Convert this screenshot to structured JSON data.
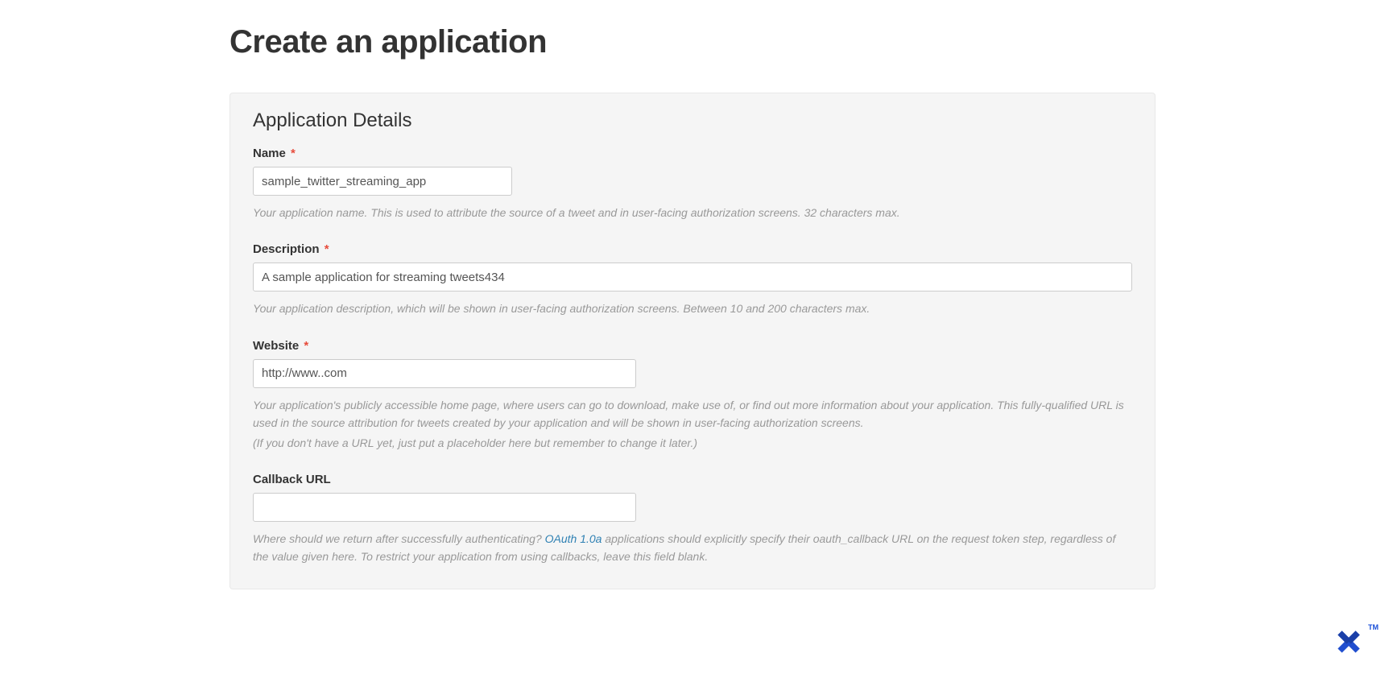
{
  "page": {
    "title": "Create an application"
  },
  "section": {
    "title": "Application Details"
  },
  "fields": {
    "name": {
      "label": "Name",
      "required_mark": "*",
      "value": "sample_twitter_streaming_app",
      "help": "Your application name. This is used to attribute the source of a tweet and in user-facing authorization screens. 32 characters max."
    },
    "description": {
      "label": "Description",
      "required_mark": "*",
      "value": "A sample application for streaming tweets434",
      "help": "Your application description, which will be shown in user-facing authorization screens. Between 10 and 200 characters max."
    },
    "website": {
      "label": "Website",
      "required_mark": "*",
      "value": "http://www..com",
      "help_line1": "Your application's publicly accessible home page, where users can go to download, make use of, or find out more information about your application. This fully-qualified URL is used in the source attribution for tweets created by your application and will be shown in user-facing authorization screens.",
      "help_line2": "(If you don't have a URL yet, just put a placeholder here but remember to change it later.)"
    },
    "callback": {
      "label": "Callback URL",
      "value": "",
      "help_before_link": "Where should we return after successfully authenticating? ",
      "link_text": "OAuth 1.0a",
      "help_after_link": " applications should explicitly specify their oauth_callback URL on the request token step, regardless of the value given here. To restrict your application from using callbacks, leave this field blank."
    }
  },
  "watermark": {
    "tm": "TM"
  }
}
